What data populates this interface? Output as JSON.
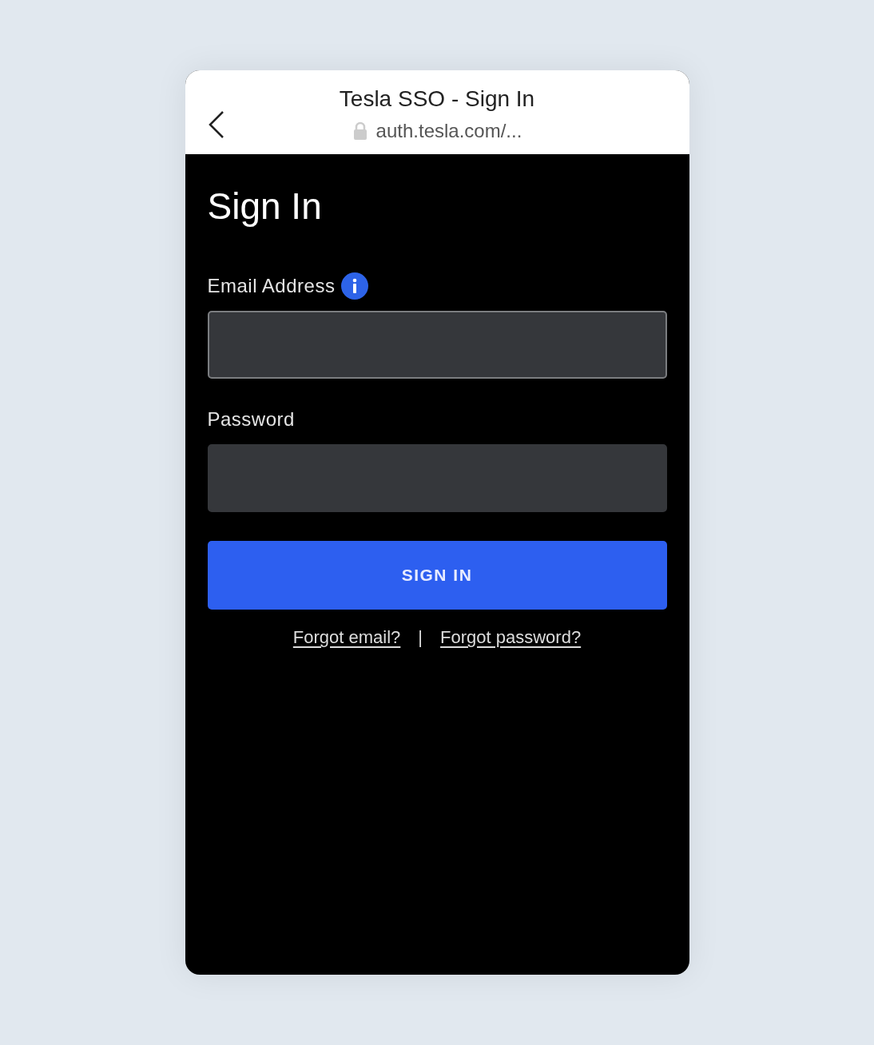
{
  "browser_bar": {
    "title": "Tesla SSO - Sign In",
    "url": "auth.tesla.com/..."
  },
  "heading": "Sign In",
  "fields": [
    {
      "label": "Email Address",
      "info": true,
      "focused": true
    },
    {
      "label": "Password",
      "info": false,
      "focused": false
    }
  ],
  "submit": "SIGN IN",
  "links": [
    "Forgot email?",
    "Forgot password?"
  ],
  "link_separator": "|"
}
